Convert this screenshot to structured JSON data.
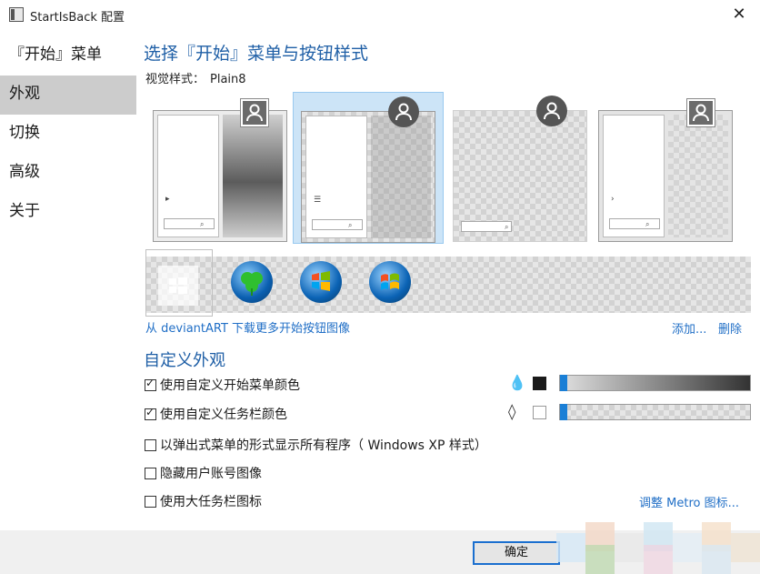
{
  "window": {
    "title": "StartIsBack 配置",
    "close_glyph": "✕"
  },
  "nav": {
    "items": [
      {
        "label": "『开始』菜单"
      },
      {
        "label": "外观"
      },
      {
        "label": "切换"
      },
      {
        "label": "高级"
      },
      {
        "label": "关于"
      }
    ],
    "selected_index": 1
  },
  "main": {
    "title": "选择『开始』菜单与按钮样式",
    "visual_style_label": "视觉样式：",
    "visual_style_value": "Plain8",
    "selected_thumbnail_index": 1
  },
  "orbs": {
    "items": [
      "blank-orb",
      "clover-orb",
      "windows7-orb",
      "windows7-color-orb"
    ]
  },
  "links": {
    "deviant": "从 deviantART 下载更多开始按钮图像",
    "add": "添加...",
    "delete": "删除"
  },
  "appearance": {
    "section_title": "自定义外观",
    "options": [
      {
        "label": "使用自定义开始菜单颜色",
        "checked": true
      },
      {
        "label": "使用自定义任务栏颜色",
        "checked": true
      },
      {
        "label": "以弹出式菜单的形式显示所有程序（ Windows XP 样式）",
        "checked": false
      },
      {
        "label": "隐藏用户账号图像",
        "checked": false
      },
      {
        "label": "使用大任务栏图标",
        "checked": false
      }
    ],
    "metro_link": "调整 Metro 图标...",
    "colors": {
      "accent": "#1a7fd6",
      "title_blue": "#1f5fa6",
      "link_blue": "#1f6ec6"
    }
  },
  "footer": {
    "ok_label": "确定"
  }
}
